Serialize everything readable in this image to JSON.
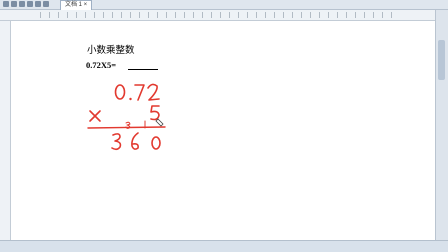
{
  "window": {
    "tab_label": "文档 1 ×"
  },
  "document": {
    "title": "小数乘整数",
    "problem": "0.72X5=",
    "handwriting": {
      "multiplicand": "0.72",
      "multiplier": "5",
      "operator": "×",
      "carries": [
        "3",
        "1"
      ],
      "product": "360"
    }
  },
  "colors": {
    "ink": "#e2392f",
    "page": "#ffffff",
    "chrome": "#dfe6ee"
  }
}
